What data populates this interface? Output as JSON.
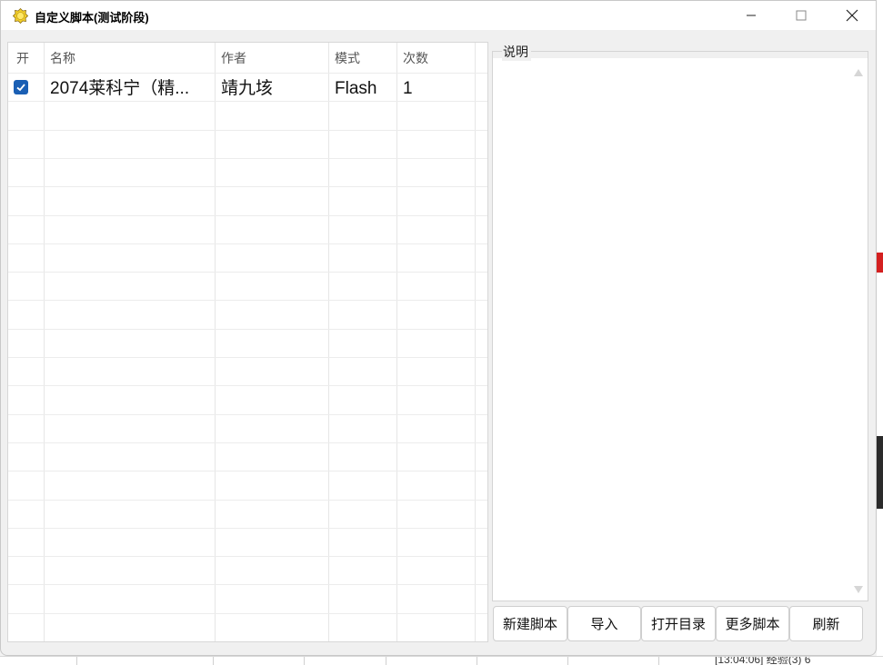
{
  "window": {
    "title": "自定义脚本(测试阶段)"
  },
  "table": {
    "columns": [
      "开",
      "名称",
      "作者",
      "模式",
      "次数"
    ],
    "rows": [
      {
        "enabled": true,
        "name": "2074莱科宁（精...",
        "author": "靖九垓",
        "mode": "Flash",
        "count": "1"
      }
    ]
  },
  "description": {
    "legend": "说明",
    "text": ""
  },
  "buttons": {
    "new_script": "新建脚本",
    "import": "导入",
    "open_dir": "打开目录",
    "more_scripts": "更多脚本",
    "refresh": "刷新"
  },
  "background": {
    "status_text": "[13:04:06] 经验(3) 6"
  },
  "colors": {
    "checkbox_accent": "#1a5fb4",
    "background_red_block": "#d42020"
  }
}
